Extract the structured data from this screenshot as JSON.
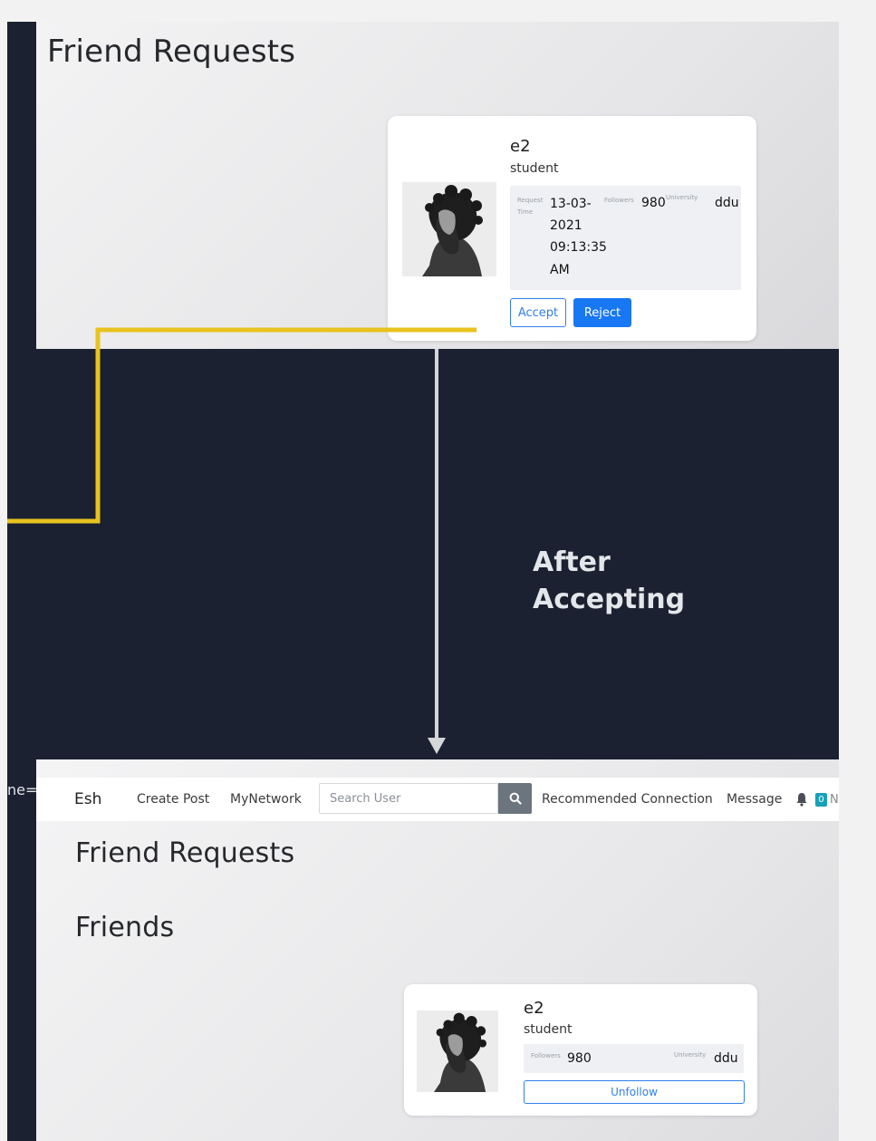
{
  "top": {
    "heading": "Friend Requests",
    "card": {
      "name": "e2",
      "role": "student",
      "request_time_label_1": "Request",
      "request_time_label_2": "Time",
      "request_time_1": "13-03-",
      "request_time_2": "2021",
      "request_time_3": "09:13:35",
      "request_time_4": "AM",
      "followers_label": "Followers",
      "followers": "980",
      "university_label": "University",
      "university": "ddu",
      "accept_label": "Accept",
      "reject_label": "Reject"
    }
  },
  "annotation": {
    "line1": "After",
    "line2": "Accepting",
    "edge_text": "ne="
  },
  "navbar": {
    "brand": "Esh",
    "create_post": "Create Post",
    "my_network": "MyNetwork",
    "search_placeholder": "Search User",
    "recommended": "Recommended Connection",
    "message": "Message",
    "notification_count": "0",
    "cut_text": "N"
  },
  "bottom": {
    "heading_requests": "Friend Requests",
    "heading_friends": "Friends",
    "card": {
      "name": "e2",
      "role": "student",
      "followers_label": "Followers",
      "followers": "980",
      "university_label": "University",
      "university": "ddu",
      "unfollow_label": "Unfollow"
    }
  },
  "colors": {
    "dark_bg": "#1b2130",
    "connector_yellow": "#e8c21e",
    "arrow_gray": "#d4d6da",
    "primary_blue": "#1877f2"
  }
}
